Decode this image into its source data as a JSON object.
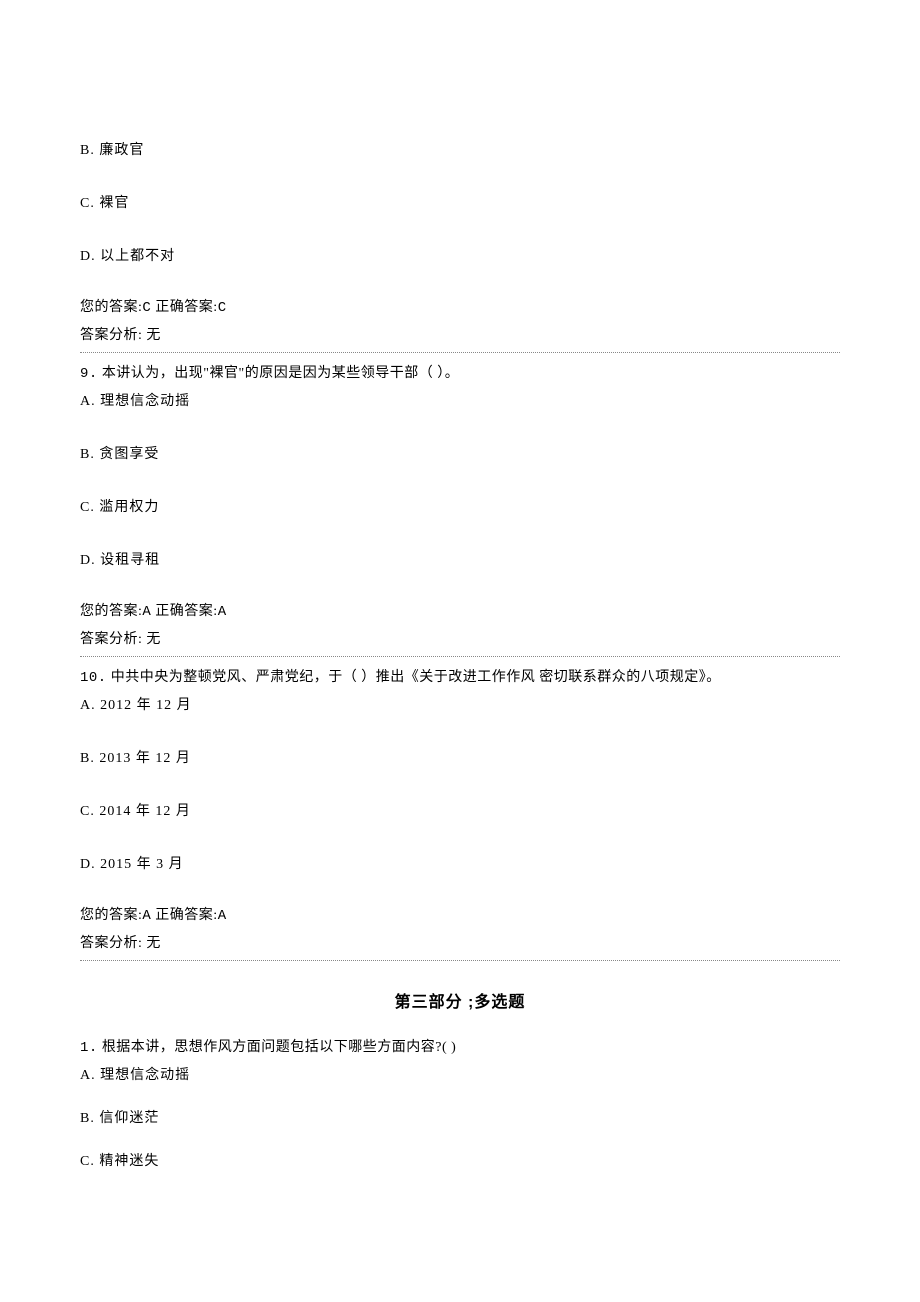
{
  "q8": {
    "optB": "B. 廉政官",
    "optC": "C. 裸官",
    "optD": "D. 以上都不对",
    "yourAnswerLabel": "您的答案:",
    "yourAnswer": "C",
    "correctLabel": "正确答案:",
    "correctAnswer": "C",
    "analysisLabel": "答案分析:",
    "analysisValue": "无"
  },
  "q9": {
    "number": "9.",
    "text": "本讲认为，出现\"裸官\"的原因是因为某些领导干部（ ）。",
    "optA": "A. 理想信念动摇",
    "optB": "B. 贪图享受",
    "optC": "C. 滥用权力",
    "optD": "D. 设租寻租",
    "yourAnswerLabel": "您的答案:",
    "yourAnswer": "A",
    "correctLabel": "正确答案:",
    "correctAnswer": "A",
    "analysisLabel": "答案分析:",
    "analysisValue": "无"
  },
  "q10": {
    "number": "10.",
    "text": "中共中央为整顿党风、严肃党纪，于（ ）推出《关于改进工作作风 密切联系群众的八项规定》。",
    "optA": "A. 2012 年 12 月",
    "optB": "B. 2013 年 12 月",
    "optC": "C. 2014 年 12 月",
    "optD": "D. 2015 年 3 月",
    "yourAnswerLabel": "您的答案:",
    "yourAnswer": "A",
    "correctLabel": "正确答案:",
    "correctAnswer": "A",
    "analysisLabel": "答案分析:",
    "analysisValue": "无"
  },
  "section3": {
    "title": "第三部分 ;多选题"
  },
  "s3q1": {
    "number": "1.",
    "text": "根据本讲，思想作风方面问题包括以下哪些方面内容?( )",
    "optA": "A. 理想信念动摇",
    "optB": "B. 信仰迷茫",
    "optC": "C. 精神迷失"
  }
}
